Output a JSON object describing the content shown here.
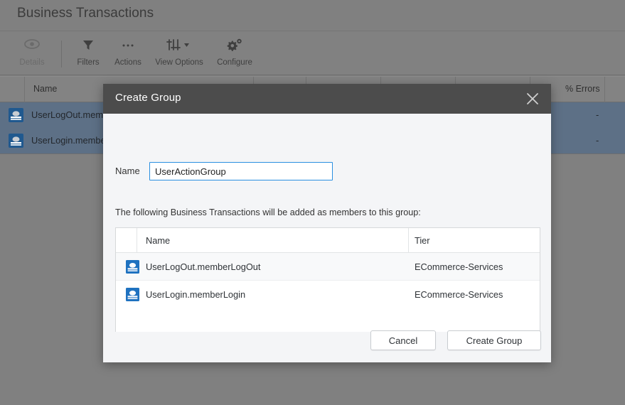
{
  "app": {
    "page_title": "Business Transactions"
  },
  "toolbar": {
    "items": [
      {
        "label": "Details",
        "icon": "eye-icon",
        "disabled": true
      },
      {
        "label": "Filters",
        "icon": "funnel-icon",
        "disabled": false
      },
      {
        "label": "Actions",
        "icon": "ellipsis-icon",
        "disabled": false
      },
      {
        "label": "View Options",
        "icon": "sliders-icon",
        "disabled": false
      },
      {
        "label": "Configure",
        "icon": "gear-icon",
        "disabled": false
      }
    ]
  },
  "background_grid": {
    "columns": [
      {
        "label": "Name"
      },
      {
        "label": "% Errors"
      }
    ],
    "rows": [
      {
        "name": "UserLogOut.mem",
        "errors": "-",
        "icon": "business-transaction-icon",
        "selected": true
      },
      {
        "name": "UserLogin.membe",
        "errors": "-",
        "icon": "business-transaction-icon",
        "selected": true
      }
    ]
  },
  "modal": {
    "title": "Create Group",
    "close_icon": "close-icon",
    "name_label": "Name",
    "name_value": "UserActionGroup",
    "name_placeholder": "",
    "members_note": "The following Business Transactions will be added as members to this group:",
    "members_table": {
      "columns": [
        "",
        "Name",
        "Tier"
      ],
      "rows": [
        {
          "icon": "business-transaction-icon",
          "name": "UserLogOut.memberLogOut",
          "tier": "ECommerce-Services"
        },
        {
          "icon": "business-transaction-icon",
          "name": "UserLogin.memberLogin",
          "tier": "ECommerce-Services"
        }
      ]
    },
    "cancel_label": "Cancel",
    "create_label": "Create Group"
  },
  "colors": {
    "modal_header": "#4c4c4c",
    "modal_body": "#f4f5f7",
    "input_focus_border": "#2a8fe0",
    "row_selected": "#5d7086",
    "icon_blue": "#1f72c0",
    "backdrop": "#808080"
  }
}
